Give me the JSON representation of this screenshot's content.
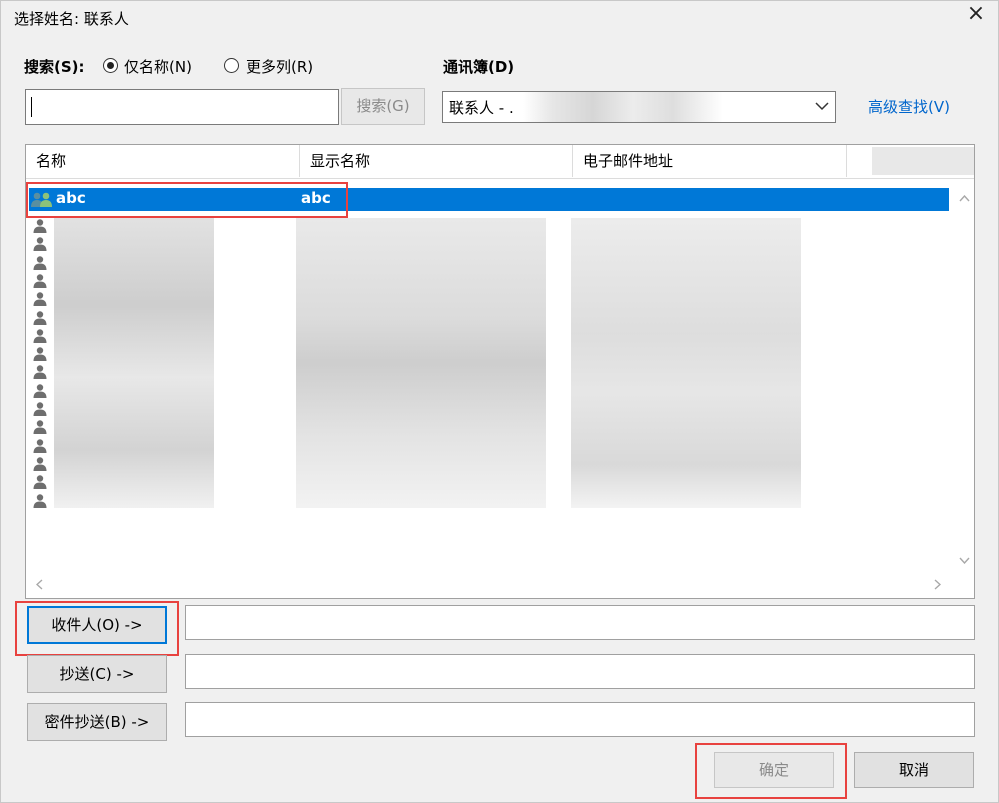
{
  "window": {
    "title": "选择姓名: 联系人",
    "close_icon": "×"
  },
  "search": {
    "label": "搜索(S):",
    "option_name_only": "仅名称(N)",
    "option_more_columns": "更多列(R)",
    "selected_option": "name_only",
    "input_value": "",
    "button_label": "搜索(G)"
  },
  "address_book": {
    "label": "通讯簿(D)",
    "selected_value": "联系人 - .",
    "advanced_link": "高级查找(V)"
  },
  "list": {
    "columns": [
      "名称",
      "显示名称",
      "电子邮件地址"
    ],
    "selected_row": {
      "name": "abc",
      "display_name": "abc",
      "email": ""
    },
    "selected_icon": "contact-group-icon",
    "row_icon": "person-icon",
    "other_row_count": 16
  },
  "recipients": {
    "to_button": "收件人(O) ->",
    "cc_button": "抄送(C) ->",
    "bcc_button": "密件抄送(B) ->",
    "to_value": "",
    "cc_value": "",
    "bcc_value": ""
  },
  "footer": {
    "ok_button": "确定",
    "cancel_button": "取消"
  },
  "colors": {
    "selection": "#0078d7",
    "highlight_box": "#e8423f",
    "link": "#0066cc"
  }
}
